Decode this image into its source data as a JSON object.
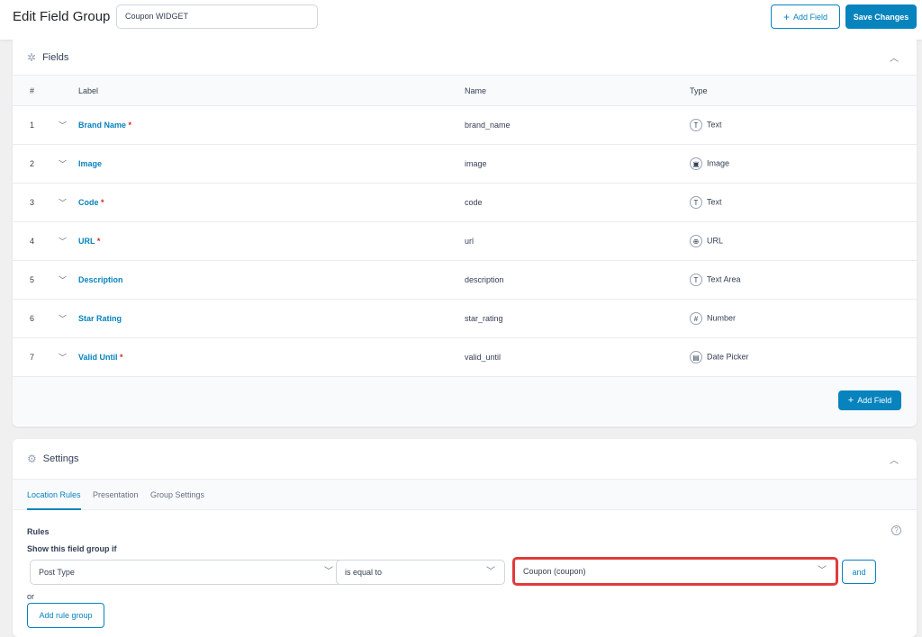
{
  "header": {
    "title": "Edit Field Group",
    "group_title": "Coupon WIDGET",
    "add_field": "Add Field",
    "save": "Save Changes"
  },
  "fields_panel": {
    "title": "Fields",
    "columns": {
      "num": "#",
      "label": "Label",
      "name": "Name",
      "type": "Type"
    },
    "rows": [
      {
        "num": "1",
        "label": "Brand Name",
        "required": "*",
        "name": "brand_name",
        "type": "Text",
        "icon": "T"
      },
      {
        "num": "2",
        "label": "Image",
        "required": "",
        "name": "image",
        "type": "Image",
        "icon": "▣"
      },
      {
        "num": "3",
        "label": "Code",
        "required": "*",
        "name": "code",
        "type": "Text",
        "icon": "T"
      },
      {
        "num": "4",
        "label": "URL",
        "required": "*",
        "name": "url",
        "type": "URL",
        "icon": "⊕"
      },
      {
        "num": "5",
        "label": "Description",
        "required": "",
        "name": "description",
        "type": "Text Area",
        "icon": "T"
      },
      {
        "num": "6",
        "label": "Star Rating",
        "required": "",
        "name": "star_rating",
        "type": "Number",
        "icon": "#"
      },
      {
        "num": "7",
        "label": "Valid Until",
        "required": "*",
        "name": "valid_until",
        "type": "Date Picker",
        "icon": "▤"
      }
    ],
    "add_field": "Add Field"
  },
  "settings_panel": {
    "title": "Settings",
    "tabs": [
      "Location Rules",
      "Presentation",
      "Group Settings"
    ],
    "rules_label": "Rules",
    "show_if": "Show this field group if",
    "param": "Post Type",
    "operator": "is equal to",
    "value": "Coupon (coupon)",
    "and": "and",
    "or": "or",
    "add_rule_group": "Add rule group"
  },
  "colors": {
    "accent": "#0783be",
    "highlight": "#e03b3b"
  }
}
